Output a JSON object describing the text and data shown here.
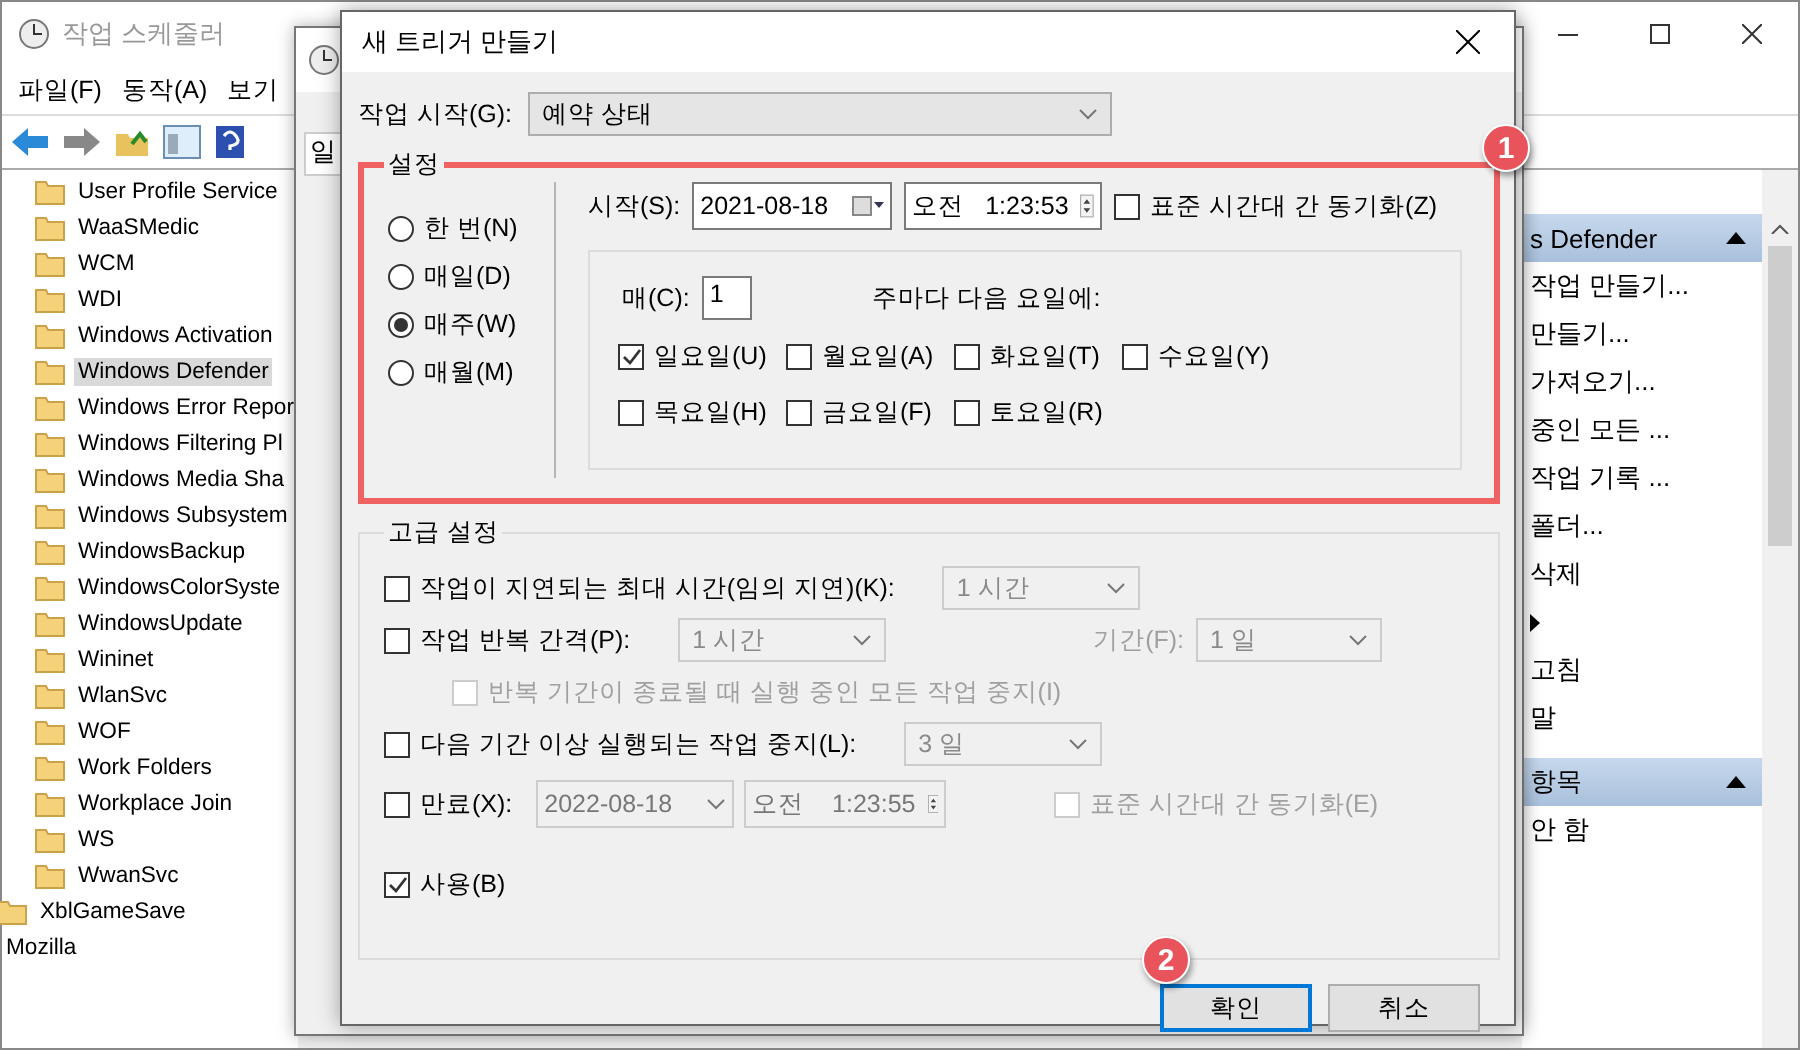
{
  "main_window": {
    "title": "작업 스케줄러",
    "menu": [
      "파일(F)",
      "동작(A)",
      "보기"
    ],
    "tree": [
      {
        "children": [
          {
            "children": [
              {
                "label": "User Profile Service",
                "selected": false
              },
              {
                "label": "WaaSMedic",
                "selected": false
              },
              {
                "label": "WCM",
                "selected": false
              },
              {
                "label": "WDI",
                "selected": false
              },
              {
                "label": "Windows Activation",
                "selected": false
              },
              {
                "label": "Windows Defender",
                "selected": true
              },
              {
                "label": "Windows Error Repor",
                "selected": false
              },
              {
                "label": "Windows Filtering Pl",
                "selected": false
              },
              {
                "label": "Windows Media Sha",
                "selected": false
              },
              {
                "label": "Windows Subsystem",
                "selected": false
              },
              {
                "label": "WindowsBackup",
                "selected": false
              },
              {
                "label": "WindowsColorSyste",
                "selected": false
              },
              {
                "label": "WindowsUpdate",
                "selected": false
              },
              {
                "label": "Wininet",
                "selected": false
              },
              {
                "label": "WlanSvc",
                "selected": false
              },
              {
                "label": "WOF",
                "selected": false
              },
              {
                "label": "Work Folders",
                "selected": false
              },
              {
                "label": "Workplace Join",
                "selected": false
              },
              {
                "label": "WS",
                "selected": false
              },
              {
                "label": "WwanSvc",
                "selected": false
              }
            ]
          },
          {
            "label": "XblGameSave",
            "selected": false
          }
        ]
      },
      {
        "label": "Mozilla",
        "selected": false
      }
    ],
    "actions": [
      {
        "header": "s Defender",
        "items": [
          {
            "label": "작업 만들기..."
          },
          {
            "label": "만들기..."
          },
          {
            "label": "가져오기..."
          },
          {
            "label": "중인 모든 ..."
          },
          {
            "label": "작업 기록 ..."
          },
          {
            "label": "폴더..."
          },
          {
            "label": "삭제"
          },
          {
            "submenu": true
          },
          {
            "label": "고침"
          },
          {
            "label": "말"
          }
        ]
      },
      {
        "header": "항목",
        "items": [
          {
            "label": "안 함"
          }
        ]
      }
    ]
  },
  "background_window": {
    "tab": "일"
  },
  "dialog": {
    "title": "새 트리거 만들기",
    "begin_label": "작업 시작(G):",
    "begin_value": "예약 상태",
    "settings": {
      "legend": "설정",
      "schedules": [
        {
          "label": "한 번(N)",
          "selected": false
        },
        {
          "label": "매일(D)",
          "selected": false
        },
        {
          "label": "매주(W)",
          "selected": true
        },
        {
          "label": "매월(M)",
          "selected": false
        }
      ],
      "start_label": "시작(S):",
      "start_date": "2021-08-18",
      "start_ampm": "오전",
      "start_time": "1:23:53",
      "sync": {
        "label": "표준 시간대 간 동기화(Z)",
        "checked": false
      },
      "every_label": "매(C):",
      "every_value": "1",
      "weekday_caption": "주마다 다음 요일에:",
      "weekdays": [
        {
          "label": "일요일(U)",
          "checked": true
        },
        {
          "label": "월요일(A)",
          "checked": false
        },
        {
          "label": "화요일(T)",
          "checked": false
        },
        {
          "label": "수요일(Y)",
          "checked": false
        },
        {
          "label": "목요일(H)",
          "checked": false
        },
        {
          "label": "금요일(F)",
          "checked": false
        },
        {
          "label": "토요일(R)",
          "checked": false
        }
      ]
    },
    "advanced": {
      "legend": "고급 설정",
      "rows": [
        {
          "kind": "combo",
          "label": "작업이 지연되는 최대 시간(임의 지연)(K):",
          "checked": false,
          "combo": {
            "value": "1 시간",
            "disabled": true
          }
        },
        {
          "kind": "combo",
          "label": "작업 반복 간격(P):",
          "checked": false,
          "combo": {
            "value": "1 시간",
            "disabled": true
          },
          "extra_label": "기간(F):",
          "extra_combo": {
            "value": "1 일",
            "disabled": true
          }
        },
        {
          "kind": "sub",
          "label": "반복 기간이 종료될 때 실행 중인 모든 작업 중지(I)",
          "checked": false,
          "disabled": true
        },
        {
          "kind": "combo",
          "label": "다음 기간 이상 실행되는 작업 중지(L):",
          "checked": false,
          "combo": {
            "value": "3 일",
            "disabled": true
          }
        },
        {
          "kind": "expire",
          "label": "만료(X):",
          "checked": false,
          "date": "2022-08-18",
          "ampm": "오전",
          "time": "1:23:55",
          "sync": {
            "label": "표준 시간대 간 동기화(E)",
            "checked": false,
            "disabled": true
          }
        },
        {
          "kind": "check",
          "label": "사용(B)",
          "checked": true
        }
      ]
    },
    "buttons": [
      {
        "label": "확인",
        "focused": true
      },
      {
        "label": "취소",
        "focused": false
      }
    ]
  },
  "annotations": [
    "1",
    "2"
  ]
}
